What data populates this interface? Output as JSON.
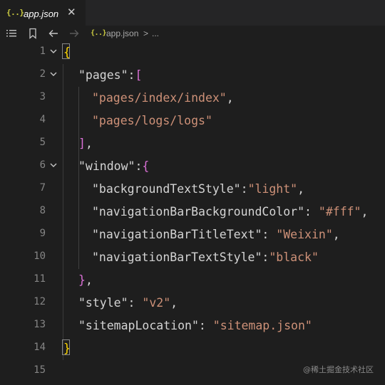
{
  "tab": {
    "icon": "{..}",
    "title": "app.json",
    "close": "✕"
  },
  "breadcrumb": {
    "file": "app.json",
    "separator": ">",
    "rest": "..."
  },
  "watermark": "@稀土掘金技术社区",
  "lines": [
    {
      "n": "1",
      "fold": true
    },
    {
      "n": "2",
      "fold": true
    },
    {
      "n": "3",
      "fold": false
    },
    {
      "n": "4",
      "fold": false
    },
    {
      "n": "5",
      "fold": false
    },
    {
      "n": "6",
      "fold": true
    },
    {
      "n": "7",
      "fold": false
    },
    {
      "n": "8",
      "fold": false
    },
    {
      "n": "9",
      "fold": false
    },
    {
      "n": "10",
      "fold": false
    },
    {
      "n": "11",
      "fold": false
    },
    {
      "n": "12",
      "fold": false
    },
    {
      "n": "13",
      "fold": false
    },
    {
      "n": "14",
      "fold": false
    },
    {
      "n": "15",
      "fold": false
    }
  ],
  "code": {
    "l1": {
      "brace": "{"
    },
    "l2": {
      "key": "\"pages\"",
      "colon": ":",
      "bracket": "["
    },
    "l3": {
      "str": "\"pages/index/index\"",
      "comma": ","
    },
    "l4": {
      "str": "\"pages/logs/logs\""
    },
    "l5": {
      "bracket": "]",
      "comma": ","
    },
    "l6": {
      "key": "\"window\"",
      "colon": ":",
      "brace": "{"
    },
    "l7": {
      "key": "\"backgroundTextStyle\"",
      "colon": ":",
      "str": "\"light\"",
      "comma": ","
    },
    "l8": {
      "key": "\"navigationBarBackgroundColor\"",
      "colon": ": ",
      "str": "\"#fff\"",
      "comma": ","
    },
    "l9": {
      "key": "\"navigationBarTitleText\"",
      "colon": ": ",
      "str": "\"Weixin\"",
      "comma": ","
    },
    "l10": {
      "key": "\"navigationBarTextStyle\"",
      "colon": ":",
      "str": "\"black\""
    },
    "l11": {
      "brace": "}",
      "comma": ","
    },
    "l12": {
      "key": "\"style\"",
      "colon": ": ",
      "str": "\"v2\"",
      "comma": ","
    },
    "l13": {
      "key": "\"sitemapLocation\"",
      "colon": ": ",
      "str": "\"sitemap.json\""
    },
    "l14": {
      "brace": "}"
    }
  },
  "colors": {
    "background": "#1e1e1e",
    "tabbar": "#252526",
    "string": "#ce9178",
    "brace_gold": "#ffd700",
    "bracket_purple": "#da70d6",
    "line_number": "#858585",
    "json_icon": "#cbcb41"
  }
}
